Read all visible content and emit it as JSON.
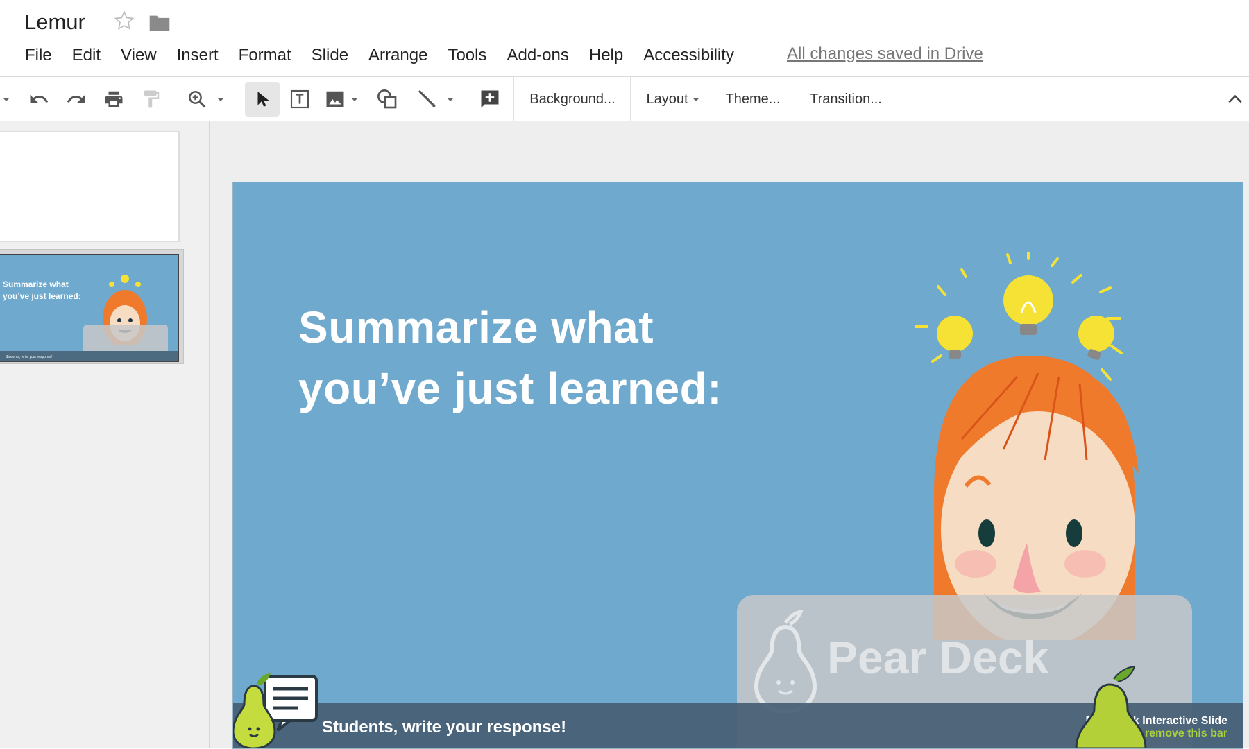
{
  "doc": {
    "title": "Lemur"
  },
  "menu": {
    "items": [
      "File",
      "Edit",
      "View",
      "Insert",
      "Format",
      "Slide",
      "Arrange",
      "Tools",
      "Add-ons",
      "Help",
      "Accessibility"
    ],
    "saved_status": "All changes saved in Drive"
  },
  "toolbar": {
    "background_label": "Background...",
    "layout_label": "Layout",
    "theme_label": "Theme...",
    "transition_label": "Transition..."
  },
  "slide": {
    "title_line1": "Summarize what",
    "title_line2": "you’ve just learned:",
    "bar_text": "Students, write your response!",
    "brand_line1": "Pear Deck Interactive Slide",
    "brand_line2": "Do not remove this bar",
    "card_logo": "Pear Deck"
  },
  "thumbnail": {
    "title_line1": "Summarize what",
    "title_line2": "you’ve just learned:",
    "bar_text": "Students, write your response!"
  },
  "colors": {
    "slide_bg": "#6fa9cd",
    "bar_bg": "#466074",
    "brand_green": "#a8cf3f"
  }
}
